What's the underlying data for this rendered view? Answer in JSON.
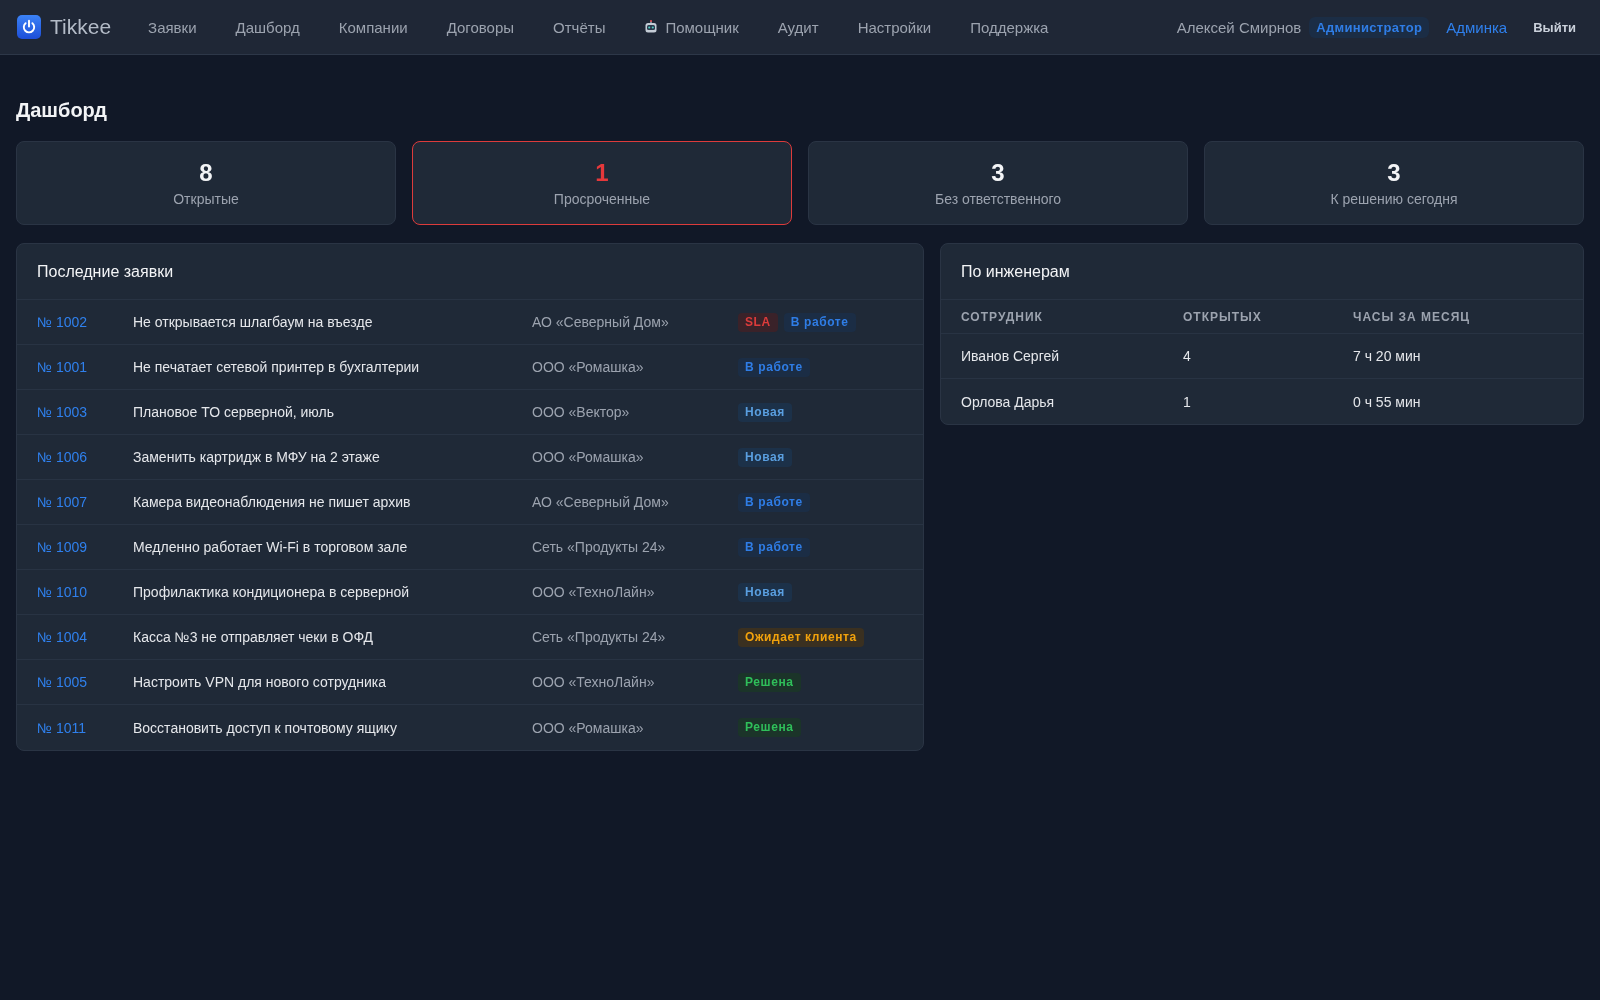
{
  "header": {
    "brand": "Tikkee",
    "nav": [
      {
        "label": "Заявки",
        "kind": "text"
      },
      {
        "label": "Дашборд",
        "kind": "text"
      },
      {
        "label": "Компании",
        "kind": "text"
      },
      {
        "label": "Договоры",
        "kind": "text"
      },
      {
        "label": "Отчёты",
        "kind": "text"
      },
      {
        "label": "Помощник",
        "kind": "icon_text"
      },
      {
        "label": "Аудит",
        "kind": "text"
      },
      {
        "label": "Настройки",
        "kind": "text"
      },
      {
        "label": "Поддержка",
        "kind": "text"
      }
    ],
    "user": {
      "name": "Алексей Смирнов",
      "role": "Администратор"
    },
    "admin_link": "Админка",
    "logout": "Выйти"
  },
  "page_title": "Дашборд",
  "stats": [
    {
      "value": "8",
      "label": "Открытые",
      "alert": false
    },
    {
      "value": "1",
      "label": "Просроченные",
      "alert": true
    },
    {
      "value": "3",
      "label": "Без ответственного",
      "alert": false
    },
    {
      "value": "3",
      "label": "К решению сегодня",
      "alert": false
    }
  ],
  "recent_tickets": {
    "title": "Последние заявки",
    "rows": [
      {
        "id": "№ 1002",
        "title": "Не открывается шлагбаум на въезде",
        "company": "АО «Северный Дом»",
        "badges": [
          {
            "text": "SLA",
            "kind": "sla"
          },
          {
            "text": "В работе",
            "kind": "in_progress"
          }
        ]
      },
      {
        "id": "№ 1001",
        "title": "Не печатает сетевой принтер в бухгалтерии",
        "company": "ООО «Ромашка»",
        "badges": [
          {
            "text": "В работе",
            "kind": "in_progress"
          }
        ]
      },
      {
        "id": "№ 1003",
        "title": "Плановое ТО серверной, июль",
        "company": "ООО «Вектор»",
        "badges": [
          {
            "text": "Новая",
            "kind": "new"
          }
        ]
      },
      {
        "id": "№ 1006",
        "title": "Заменить картридж в МФУ на 2 этаже",
        "company": "ООО «Ромашка»",
        "badges": [
          {
            "text": "Новая",
            "kind": "new"
          }
        ]
      },
      {
        "id": "№ 1007",
        "title": "Камера видеонаблюдения не пишет архив",
        "company": "АО «Северный Дом»",
        "badges": [
          {
            "text": "В работе",
            "kind": "in_progress"
          }
        ]
      },
      {
        "id": "№ 1009",
        "title": "Медленно работает Wi-Fi в торговом зале",
        "company": "Сеть «Продукты 24»",
        "badges": [
          {
            "text": "В работе",
            "kind": "in_progress"
          }
        ]
      },
      {
        "id": "№ 1010",
        "title": "Профилактика кондиционера в серверной",
        "company": "ООО «ТехноЛайн»",
        "badges": [
          {
            "text": "Новая",
            "kind": "new"
          }
        ]
      },
      {
        "id": "№ 1004",
        "title": "Касса №3 не отправляет чеки в ОФД",
        "company": "Сеть «Продукты 24»",
        "badges": [
          {
            "text": "Ожидает клиента",
            "kind": "waiting"
          }
        ]
      },
      {
        "id": "№ 1005",
        "title": "Настроить VPN для нового сотрудника",
        "company": "ООО «ТехноЛайн»",
        "badges": [
          {
            "text": "Решена",
            "kind": "resolved"
          }
        ]
      },
      {
        "id": "№ 1011",
        "title": "Восстановить доступ к почтовому ящику",
        "company": "ООО «Ромашка»",
        "badges": [
          {
            "text": "Решена",
            "kind": "resolved"
          }
        ]
      }
    ]
  },
  "engineers": {
    "title": "По инженерам",
    "columns": [
      "СОТРУДНИК",
      "ОТКРЫТЫХ",
      "ЧАСЫ ЗА МЕСЯЦ"
    ],
    "rows": [
      {
        "cells": [
          "Иванов Сергей",
          "4",
          "7 ч 20 мин"
        ]
      },
      {
        "cells": [
          "Орлова Дарья",
          "1",
          "0 ч 55 мин"
        ]
      }
    ]
  }
}
